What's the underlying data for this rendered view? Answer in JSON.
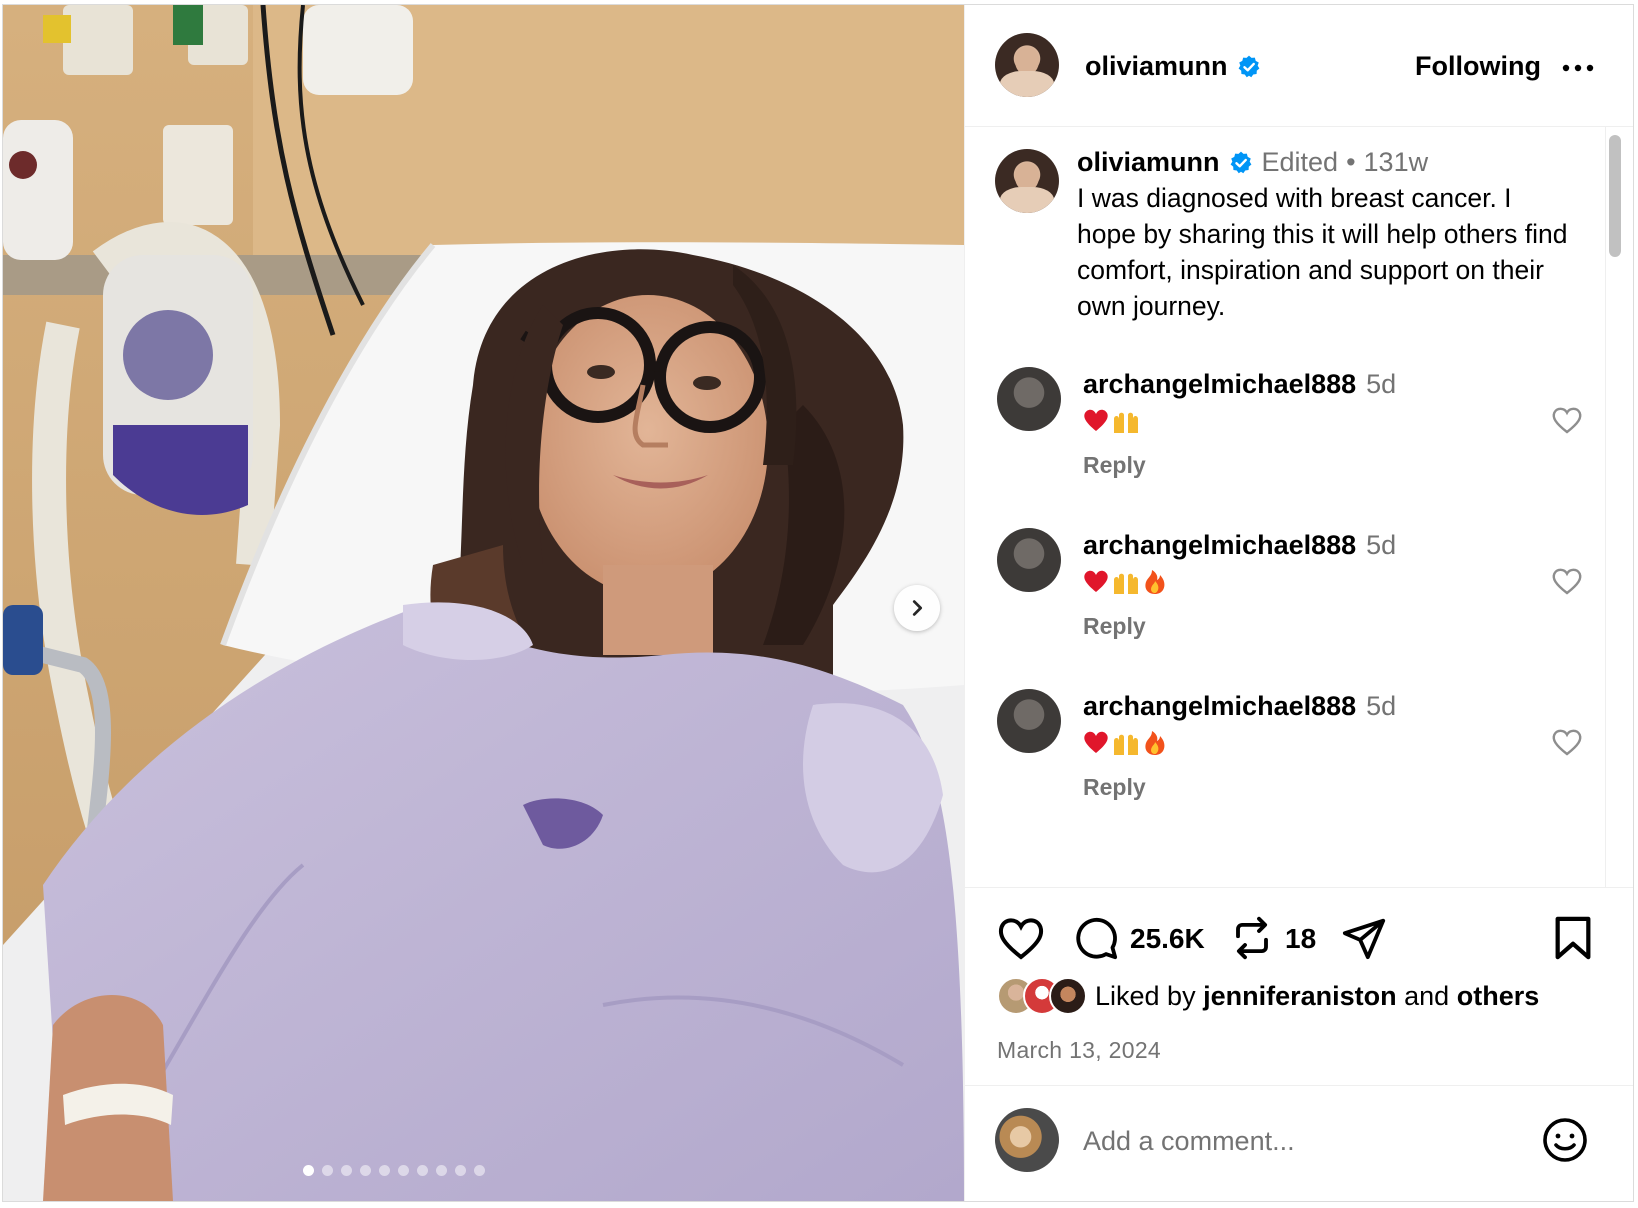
{
  "post": {
    "username": "oliviamunn",
    "follow_state": "Following",
    "photo_count": 10,
    "photo_index": 1
  },
  "caption": {
    "username": "oliviamunn",
    "edited": "Edited",
    "separator": "•",
    "age": "131w",
    "text": "I was diagnosed with breast cancer. I hope by sharing this it will help others find comfort, inspiration and support on their own journey."
  },
  "comments": [
    {
      "username": "archangelmichael888",
      "age": "5d",
      "emojis": [
        "❤️",
        "🙌"
      ],
      "reply": "Reply"
    },
    {
      "username": "archangelmichael888",
      "age": "5d",
      "emojis": [
        "❤️",
        "🙌",
        "🔥"
      ],
      "reply": "Reply"
    },
    {
      "username": "archangelmichael888",
      "age": "5d",
      "emojis": [
        "❤️",
        "🙌",
        "🔥"
      ],
      "reply": "Reply"
    }
  ],
  "actions": {
    "comment_count": "25.6K",
    "repost_count": "18"
  },
  "likes": {
    "prefix": "Liked by",
    "user": "jenniferaniston",
    "and": "and",
    "others": "others"
  },
  "date": "March 13, 2024",
  "add_comment": {
    "placeholder": "Add a comment..."
  },
  "icons": {
    "verified": "verified-badge-icon",
    "more": "more-dots-icon",
    "like": "heart-icon",
    "comment": "comment-bubble-icon",
    "repost": "repost-icon",
    "share": "send-icon",
    "save": "bookmark-icon",
    "emoji": "smiley-icon",
    "next": "chevron-right-icon"
  },
  "colors": {
    "verified": "#0095f6",
    "muted": "#737373",
    "border": "#dbdbdb"
  }
}
